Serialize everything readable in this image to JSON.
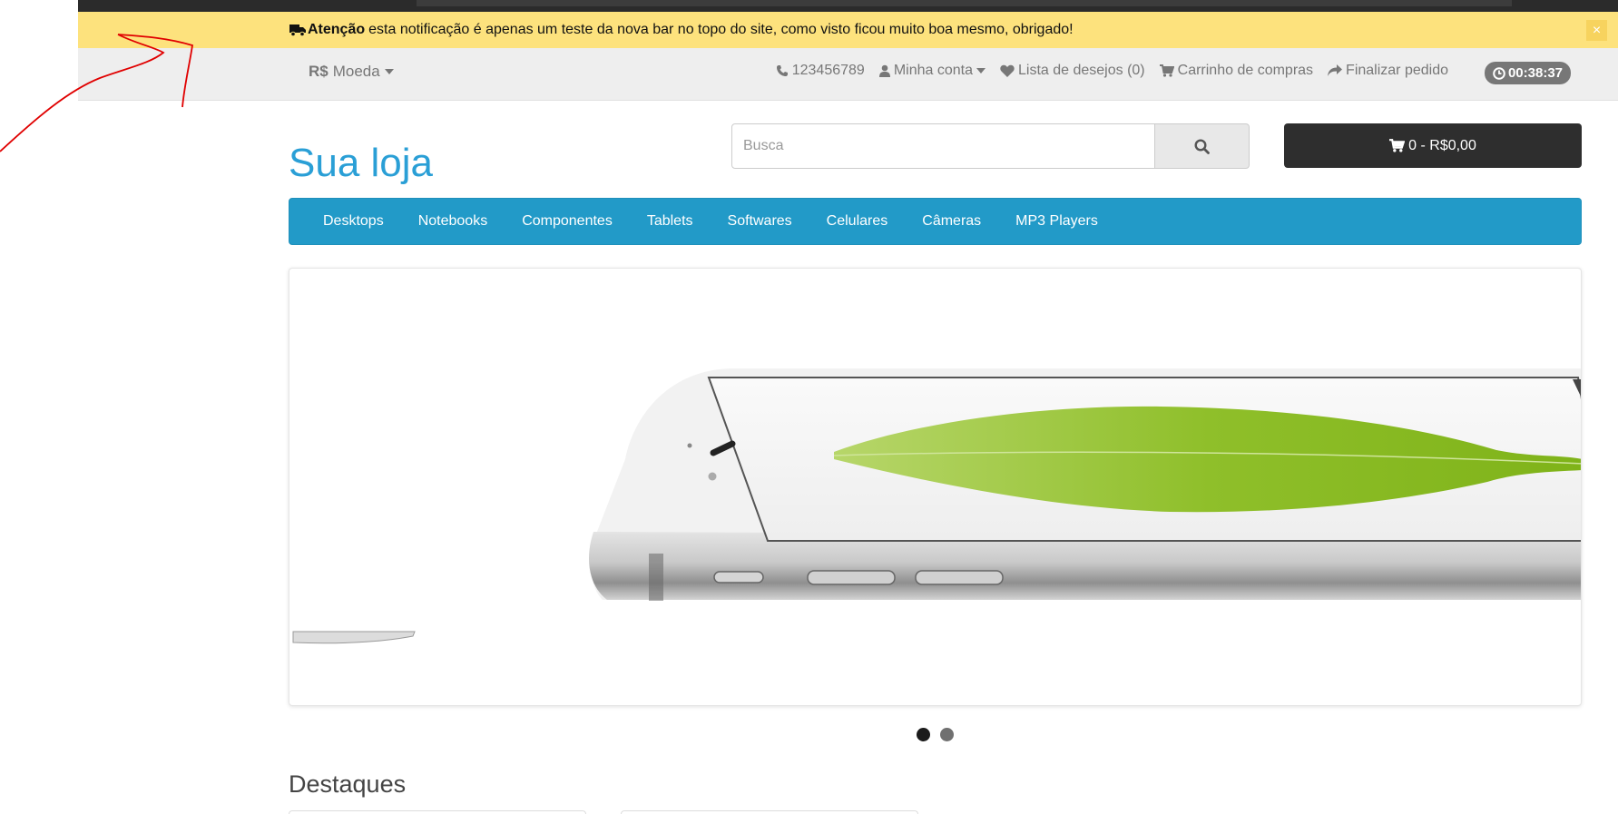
{
  "notice": {
    "title": "Atenção",
    "message": "esta notificação é apenas um teste da nova bar no topo do site, como visto ficou muito boa mesmo, obrigado!",
    "close_label": "×"
  },
  "top_links": {
    "currency_symbol": "R$",
    "currency_label": "Moeda",
    "phone": "123456789",
    "account": "Minha conta",
    "wishlist": "Lista de desejos (0)",
    "cart": "Carrinho de compras",
    "checkout": "Finalizar pedido",
    "timer": "00:38:37"
  },
  "header": {
    "logo": "Sua loja",
    "search_placeholder": "Busca",
    "cart_summary": "0 - R$0,00"
  },
  "menu": {
    "items": [
      "Desktops",
      "Notebooks",
      "Componentes",
      "Tablets",
      "Softwares",
      "Celulares",
      "Câmeras",
      "MP3 Players"
    ]
  },
  "slideshow": {
    "dots": 2,
    "active_index": 0
  },
  "featured": {
    "title": "Destaques"
  },
  "colors": {
    "accent": "#229ac8",
    "logo": "#2a9fd6",
    "notice_bg": "#fde27d",
    "annotation": "#e00000"
  }
}
